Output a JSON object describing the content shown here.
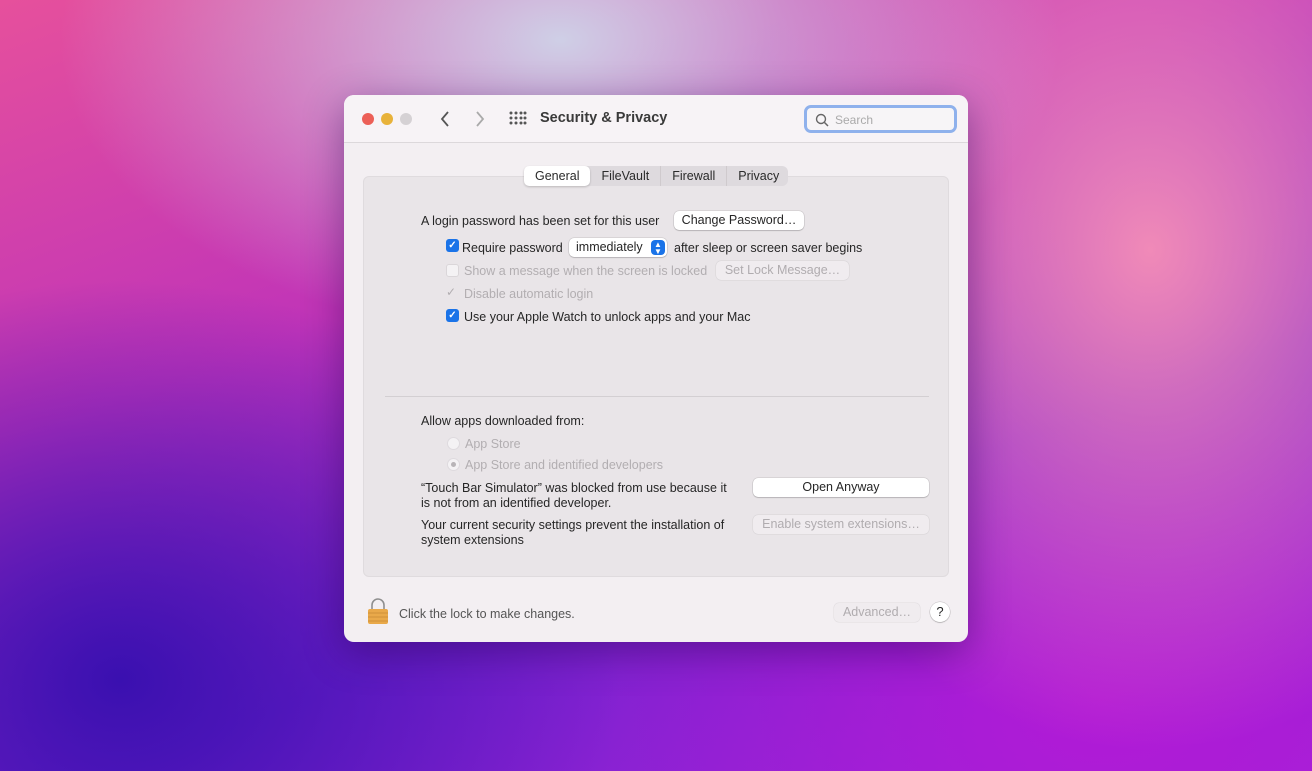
{
  "window": {
    "title": "Security & Privacy",
    "search_placeholder": "Search"
  },
  "tabs": [
    {
      "label": "General",
      "selected": true
    },
    {
      "label": "FileVault"
    },
    {
      "label": "Firewall"
    },
    {
      "label": "Privacy"
    }
  ],
  "general": {
    "login_text": "A login password has been set for this user",
    "change_password": "Change Password…",
    "require_password": {
      "label": "Require password",
      "checked": true,
      "value": "immediately",
      "suffix": "after sleep or screen saver begins"
    },
    "show_message": {
      "label": "Show a message when the screen is locked",
      "checked": false,
      "button": "Set Lock Message…"
    },
    "disable_login": {
      "label": "Disable automatic login",
      "checked": true
    },
    "apple_watch": {
      "label": "Use your Apple Watch to unlock apps and your Mac",
      "checked": true
    },
    "allow_label": "Allow apps downloaded from:",
    "radio_app_store": "App Store",
    "radio_identified": "App Store and identified developers",
    "blocked_line1": "“Touch Bar Simulator” was blocked from use because it",
    "blocked_line2": "is not from an identified developer.",
    "open_anyway": "Open Anyway",
    "ext_line1": "Your current security settings prevent the installation of",
    "ext_line2": "system extensions",
    "enable_ext": "Enable system extensions…"
  },
  "footer": {
    "lock_text": "Click the lock to make changes.",
    "advanced": "Advanced…",
    "help": "?"
  },
  "colors": {
    "accent": "#1a73e8",
    "close": "#ec5f57",
    "minimize": "#e8b23a"
  }
}
